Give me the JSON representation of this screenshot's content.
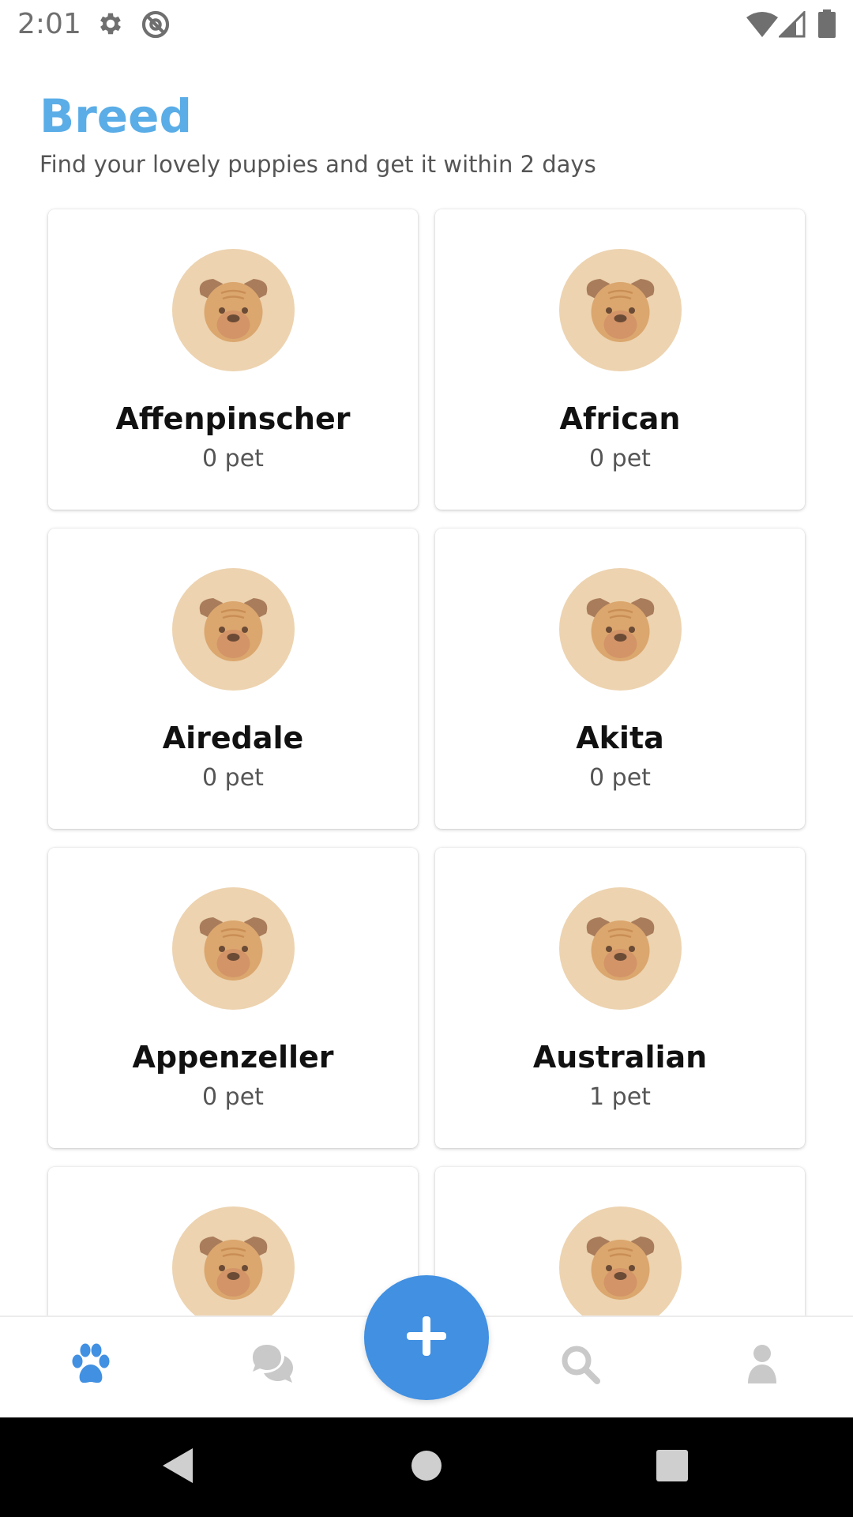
{
  "status_bar": {
    "time": "2:01",
    "icons": [
      "settings-icon",
      "at-sign-icon",
      "wifi-icon",
      "signal-icon",
      "battery-icon"
    ]
  },
  "header": {
    "title": "Breed",
    "subtitle": "Find your lovely puppies and get it within 2 days"
  },
  "breeds": [
    {
      "name": "Affenpinscher",
      "count": "0 pet"
    },
    {
      "name": "African",
      "count": "0 pet"
    },
    {
      "name": "Airedale",
      "count": "0 pet"
    },
    {
      "name": "Akita",
      "count": "0 pet"
    },
    {
      "name": "Appenzeller",
      "count": "0 pet"
    },
    {
      "name": "Australian",
      "count": "1 pet"
    }
  ],
  "bottom_nav": {
    "items": [
      "paw-icon",
      "chat-icon",
      "add-icon",
      "search-icon",
      "profile-icon"
    ],
    "active": "paw-icon"
  },
  "system_nav": [
    "back-icon",
    "home-icon",
    "recents-icon"
  ],
  "colors": {
    "title": "#5aade7",
    "accent": "#4190e2",
    "avatar_bg": "#edd3b0",
    "inactive_icon": "#c9c9c9"
  }
}
